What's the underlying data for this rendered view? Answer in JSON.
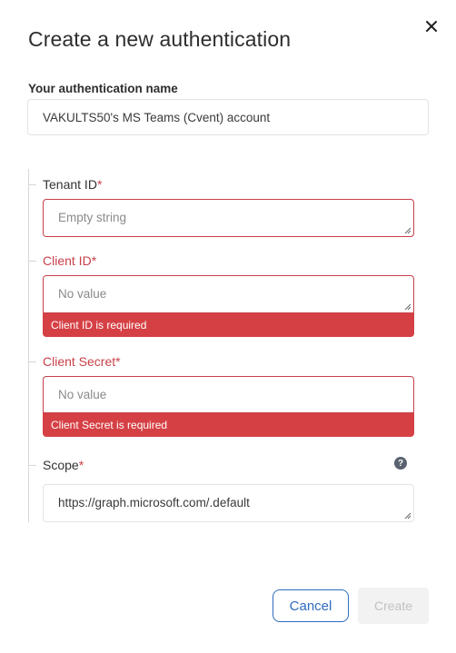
{
  "dialog": {
    "title": "Create a new authentication",
    "close_icon": "close-icon"
  },
  "auth_name": {
    "label": "Your authentication name",
    "value": "VAKULTS50's MS Teams (Cvent) account"
  },
  "fields": {
    "tenant_id": {
      "label": "Tenant ID",
      "required_mark": "*",
      "placeholder": "Empty string",
      "value": ""
    },
    "client_id": {
      "label": "Client ID",
      "required_mark": "*",
      "placeholder": "No value",
      "value": "",
      "error": "Client ID is required"
    },
    "client_secret": {
      "label": "Client Secret",
      "required_mark": "*",
      "placeholder": "No value",
      "value": "",
      "error": "Client Secret is required"
    },
    "scope": {
      "label": "Scope",
      "required_mark": "*",
      "value": "https://graph.microsoft.com/.default",
      "help_icon": "question-circle-icon"
    }
  },
  "footer": {
    "cancel_label": "Cancel",
    "create_label": "Create"
  },
  "colors": {
    "error": "#d54045",
    "accent": "#2f6cc0"
  }
}
